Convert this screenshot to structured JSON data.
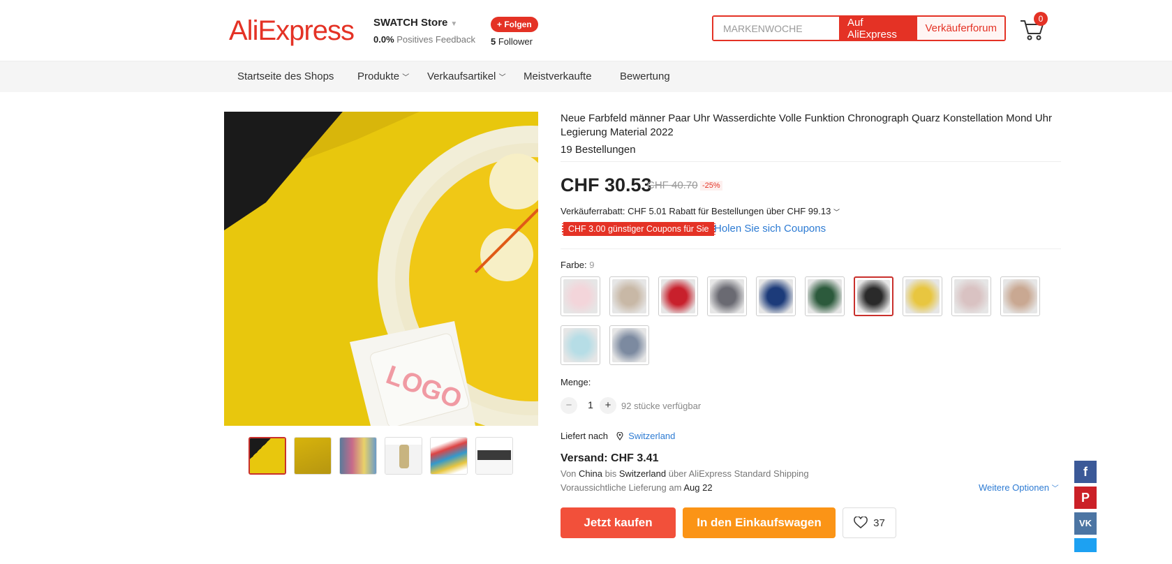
{
  "header": {
    "logo": "AliExpress",
    "store_name": "SWATCH Store",
    "feedback_value": "0.0%",
    "feedback_label": "Positives Feedback",
    "follow_label": "+ Folgen",
    "follower_count": "5",
    "follower_label": "Follower",
    "search_placeholder": "MARKENWOCHE",
    "search_ali_label": "Auf AliExpress",
    "search_forum_label": "Verkäuferforum",
    "cart_count": "0"
  },
  "nav": {
    "items": [
      "Startseite des Shops",
      "Produkte",
      "Verkaufsartikel",
      "Meistverkaufte",
      "Bewertung"
    ]
  },
  "product": {
    "title": "Neue Farbfeld männer Paar Uhr Wasserdichte Volle Funktion Chronograph Quarz Konstellation Mond Uhr Legierung Material 2022",
    "orders": "19 Bestellungen",
    "price": "CHF 30.53",
    "price_old": "CHF 40.70",
    "discount": "-25%",
    "seller_discount": "Verkäuferrabatt: CHF 5.01 Rabatt für Bestellungen über CHF 99.13",
    "coupon_tag": "CHF 3.00 günstiger Coupons für Sie",
    "coupon_link": "Holen Sie sich Coupons",
    "color_label": "Farbe:",
    "color_value": "9",
    "swatch_colors": [
      "#f3d5da",
      "#c8b8a6",
      "#c8202c",
      "#6a6a72",
      "#1c3b7a",
      "#2c5a3c",
      "#2a2a2a",
      "#e8c640",
      "#d9c2c2",
      "#c9a892",
      "#b6dde6",
      "#7c8aa0"
    ],
    "quantity_label": "Menge:",
    "quantity_value": "1",
    "available": "92 stücke verfügbar",
    "ships_to_label": "Liefert nach",
    "ships_to_country": "Switzerland",
    "shipping_cost": "Versand: CHF 3.41",
    "ship_from_prefix": "Von",
    "ship_from": "China",
    "ship_to_prefix": "bis",
    "ship_to": "Switzerland",
    "ship_method": "über AliExpress Standard Shipping",
    "delivery_prefix": "Voraussichtliche Lieferung am",
    "delivery_date": "Aug 22",
    "more_options": "Weitere Optionen",
    "buy_now": "Jetzt kaufen",
    "add_to_cart": "In den Einkaufswagen",
    "wishlist_count": "37"
  },
  "colors": {
    "brand": "#e43225",
    "buy": "#f2503a",
    "cart": "#fb9416",
    "link": "#2d7bd3"
  }
}
